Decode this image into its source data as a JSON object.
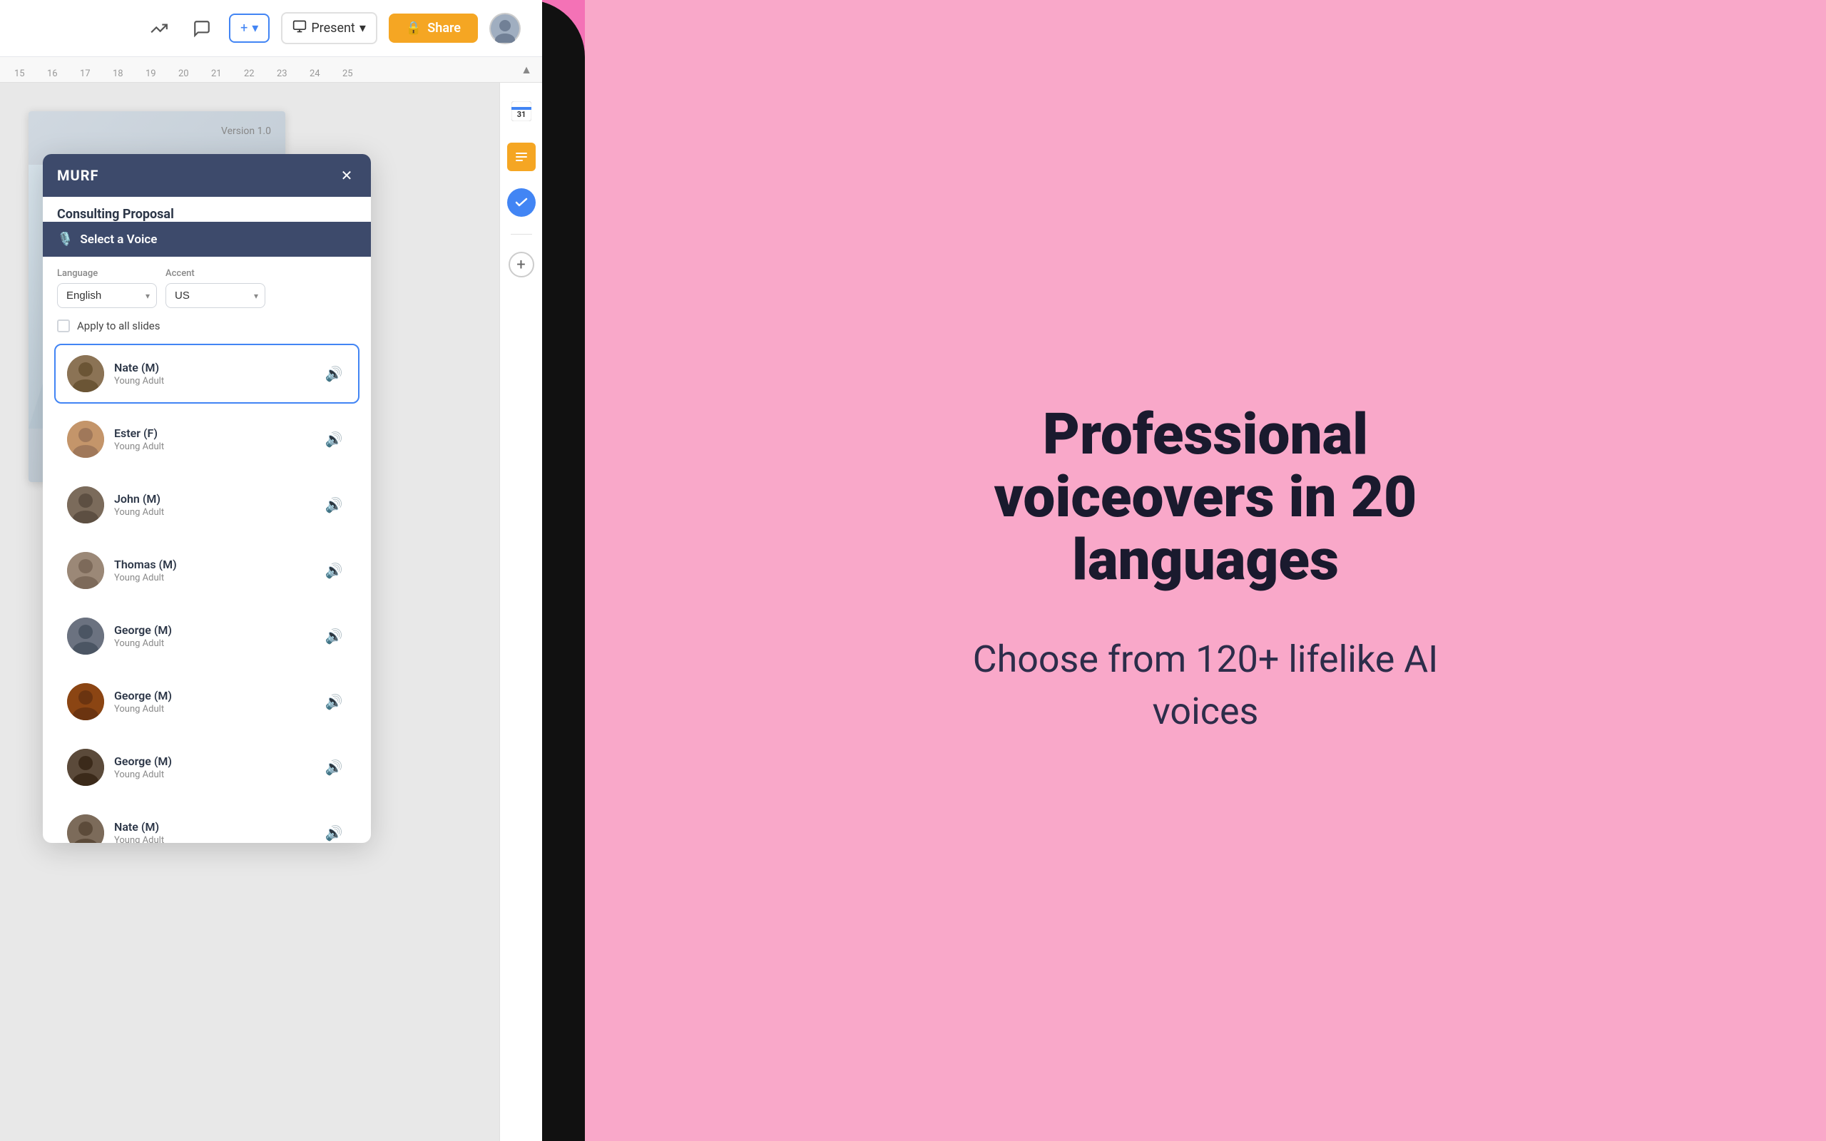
{
  "toolbar": {
    "add_label": "+",
    "present_label": "Present",
    "share_label": "Share",
    "share_icon": "🔒"
  },
  "ruler": {
    "marks": [
      "15",
      "16",
      "17",
      "18",
      "19",
      "20",
      "21",
      "22",
      "23",
      "24",
      "25"
    ]
  },
  "slide": {
    "version_label": "Version 1.0"
  },
  "modal": {
    "title": "MURF",
    "document_title": "Consulting Proposal",
    "select_voice_label": "Select a Voice",
    "language_label": "Language",
    "language_value": "English",
    "accent_label": "Accent",
    "accent_value": "US",
    "apply_label": "Apply to all slides",
    "close_icon": "✕"
  },
  "voices": [
    {
      "name": "Nate (M)",
      "age": "Young Adult",
      "selected": true,
      "face_class": "face-1",
      "emoji": "👨"
    },
    {
      "name": "Ester (F)",
      "age": "Young Adult",
      "selected": false,
      "face_class": "face-2",
      "emoji": "👩"
    },
    {
      "name": "John (M)",
      "age": "Young Adult",
      "selected": false,
      "face_class": "face-3",
      "emoji": "👨"
    },
    {
      "name": "Thomas (M)",
      "age": "Young Adult",
      "selected": false,
      "face_class": "face-4",
      "emoji": "👨"
    },
    {
      "name": "George (M)",
      "age": "Young Adult",
      "selected": false,
      "face_class": "face-5",
      "emoji": "👨"
    },
    {
      "name": "George (M)",
      "age": "Young Adult",
      "selected": false,
      "face_class": "face-6",
      "emoji": "👨"
    },
    {
      "name": "George (M)",
      "age": "Young Adult",
      "selected": false,
      "face_class": "face-7",
      "emoji": "👨"
    },
    {
      "name": "Nate (M)",
      "age": "Young Adult",
      "selected": false,
      "face_class": "face-8",
      "emoji": "👨"
    }
  ],
  "hero": {
    "title": "Professional voiceovers in 20 languages",
    "subtitle": "Choose from 120+ lifelike AI voices"
  },
  "sidebar_icons": [
    {
      "name": "gcal",
      "type": "gcal"
    },
    {
      "name": "yellow-note",
      "type": "yellow"
    },
    {
      "name": "blue-check",
      "type": "blue"
    }
  ],
  "colors": {
    "background_pink": "#f472b6",
    "modal_header": "#3d4a6b",
    "selected_border": "#4285f4",
    "share_button": "#f5a623"
  }
}
